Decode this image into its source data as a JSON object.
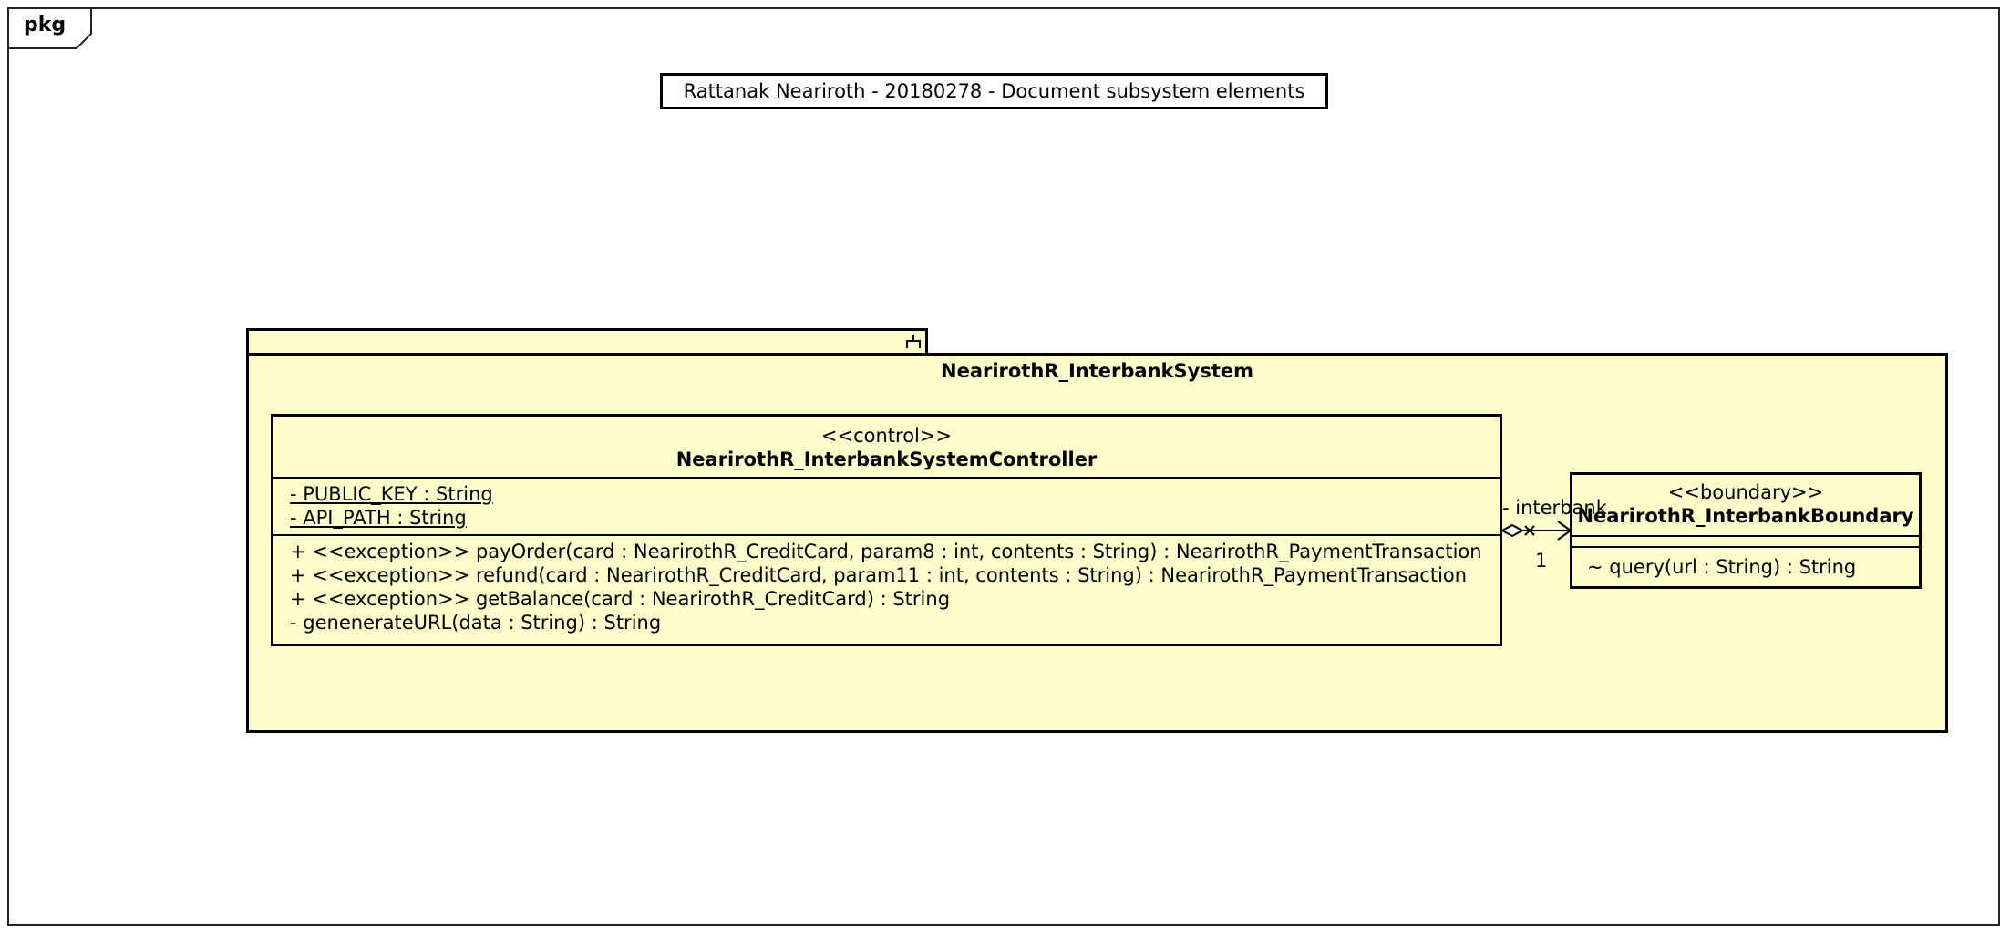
{
  "frame": {
    "tab_label": "pkg"
  },
  "note": {
    "text": "Rattanak Neariroth - 20180278 - Document subsystem elements"
  },
  "package": {
    "name": "NearirothR_InterbankSystem",
    "icon": "subsystem-fork-icon"
  },
  "controller": {
    "stereotype": "<<control>>",
    "name": "NearirothR_InterbankSystemController",
    "attributes": [
      "- PUBLIC_KEY : String",
      "- API_PATH : String"
    ],
    "operations": [
      "+ <<exception>> payOrder(card : NearirothR_CreditCard, param8 : int, contents : String) : NearirothR_PaymentTransaction",
      "+ <<exception>> refund(card : NearirothR_CreditCard, param11 : int, contents : String) : NearirothR_PaymentTransaction",
      "+ <<exception>> getBalance(card : NearirothR_CreditCard) : String",
      "- genenerateURL(data : String) : String"
    ]
  },
  "boundary": {
    "stereotype": "<<boundary>>",
    "name": "NearirothR_InterbankBoundary",
    "operations": [
      "~ query(url : String) : String"
    ]
  },
  "association": {
    "role": "- interbank",
    "multiplicity": "1"
  }
}
